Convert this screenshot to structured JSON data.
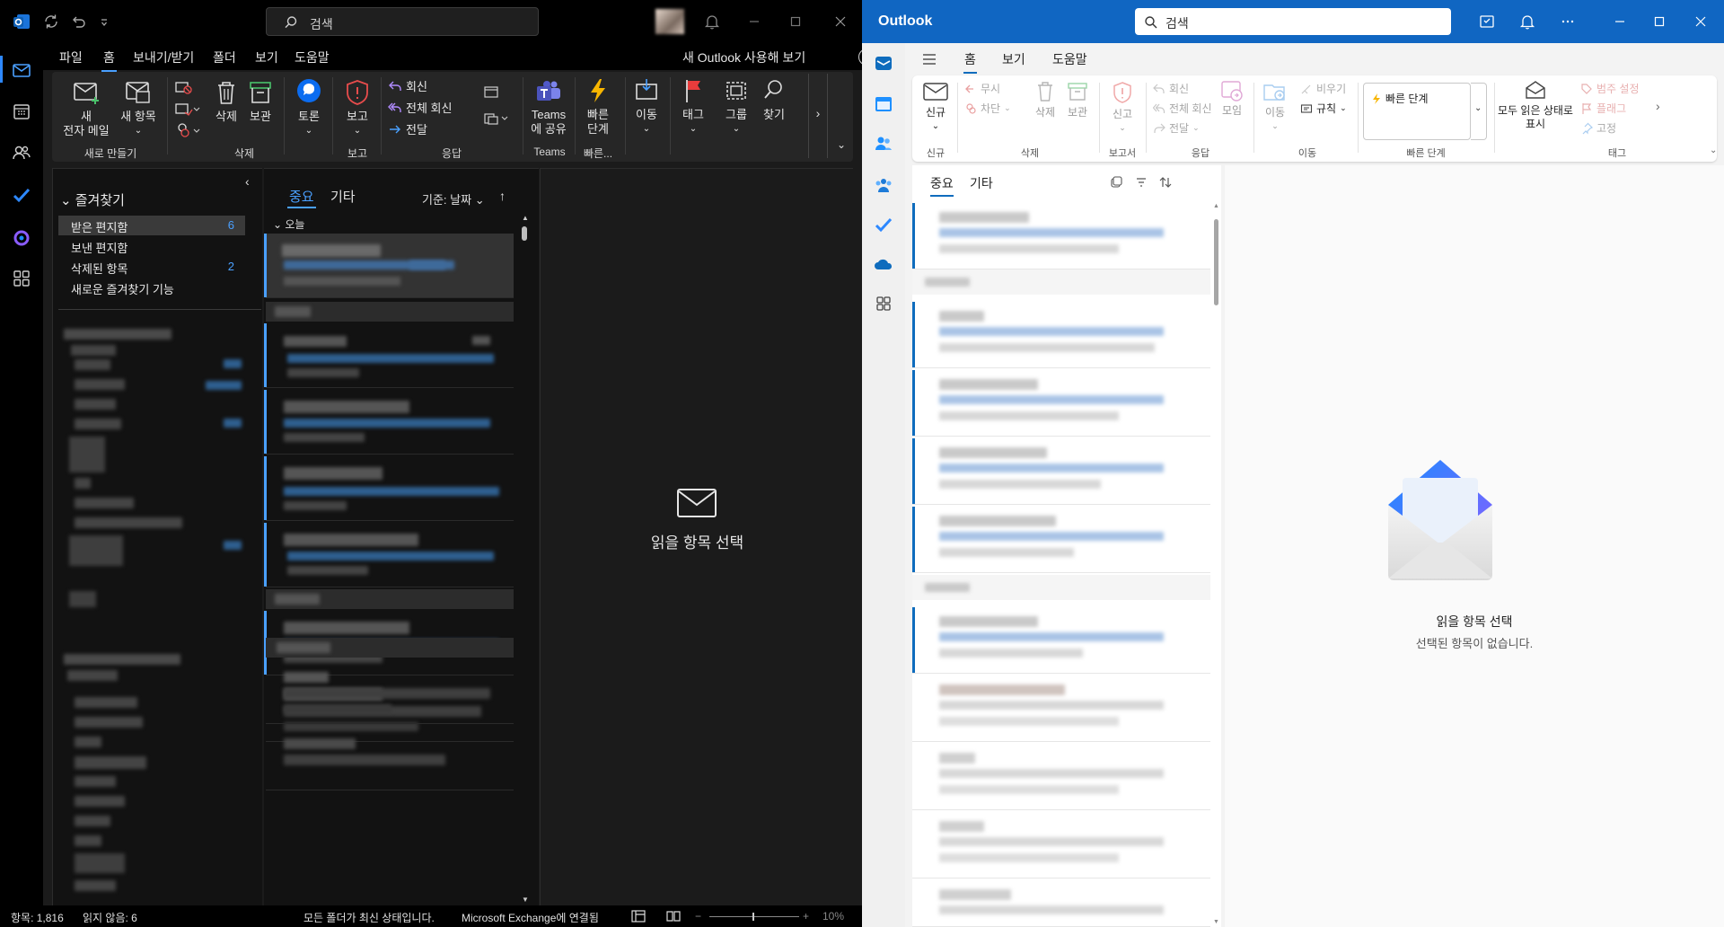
{
  "classic": {
    "search_placeholder": "검색",
    "menu_tabs": [
      "파일",
      "홈",
      "보내기/받기",
      "폴더",
      "보기",
      "도움말"
    ],
    "toggle_label": "새 Outlook 사용해 보기",
    "toggle_state": "끔",
    "ribbon": {
      "new_mail": [
        "새",
        "전자 메일"
      ],
      "new_item": "새 항목",
      "delete": "삭제",
      "archive": "보관",
      "discussion": "토론",
      "report": "보고",
      "reply": "회신",
      "reply_all": "전체 회신",
      "forward": "전달",
      "teams_share": [
        "Teams",
        "에 공유"
      ],
      "quick_steps": [
        "빠른",
        "단계"
      ],
      "move": "이동",
      "tag": "태그",
      "group": "그룹",
      "find": "찾기",
      "groups": {
        "new": "새로 만들기",
        "delete": "삭제",
        "report": "보고",
        "respond": "응답",
        "teams": "Teams",
        "quick": "빠른..."
      }
    },
    "folders": {
      "favorites_title": "즐겨찾기",
      "items": [
        {
          "label": "받은 편지함",
          "count": "6"
        },
        {
          "label": "보낸 편지함",
          "count": ""
        },
        {
          "label": "삭제된 항목",
          "count": "2"
        },
        {
          "label": "새로운 즐겨찾기 기능",
          "count": ""
        }
      ]
    },
    "list": {
      "tab_focused": "중요",
      "tab_other": "기타",
      "sort_label": "기준: 날짜",
      "group_today": "오늘"
    },
    "reading_pane": "읽을 항목 선택",
    "status": {
      "items": "항목: 1,816",
      "unread": "읽지 않음: 6",
      "sync": "모든 폴더가 최신 상태입니다.",
      "connection": "Microsoft Exchange에 연결됨",
      "zoom": "10%"
    }
  },
  "new_outlook": {
    "brand": "Outlook",
    "search_placeholder": "검색",
    "tabs": [
      "홈",
      "보기",
      "도움말"
    ],
    "ribbon": {
      "new": "신규",
      "ignore": "무시",
      "block": "차단",
      "delete": "삭제",
      "archive": "보관",
      "report": "신고",
      "reply": "회신",
      "reply_all": "전체 회신",
      "forward": "전달",
      "meeting": "모임",
      "move": "이동",
      "empty": "비우기",
      "rules": "규칙",
      "quick_steps": "빠른 단계",
      "mark_all_read": [
        "모두 읽은 상태로",
        "표시"
      ],
      "category": "범주 설정",
      "flag": "플래그",
      "pin": "고정",
      "groups": {
        "new": "신규",
        "delete": "삭제",
        "report": "보고서",
        "respond": "응답",
        "move": "이동",
        "quick": "빠른 단계",
        "tags": "태그"
      }
    },
    "list": {
      "tab_focused": "중요",
      "tab_other": "기타"
    },
    "reading_pane": {
      "title": "읽을 항목 선택",
      "subtitle": "선택된 항목이 없습니다."
    }
  },
  "colors": {
    "classic_accent": "#4aa0ff",
    "new_brand": "#1066c2",
    "new_accent": "#0f6cbd"
  }
}
